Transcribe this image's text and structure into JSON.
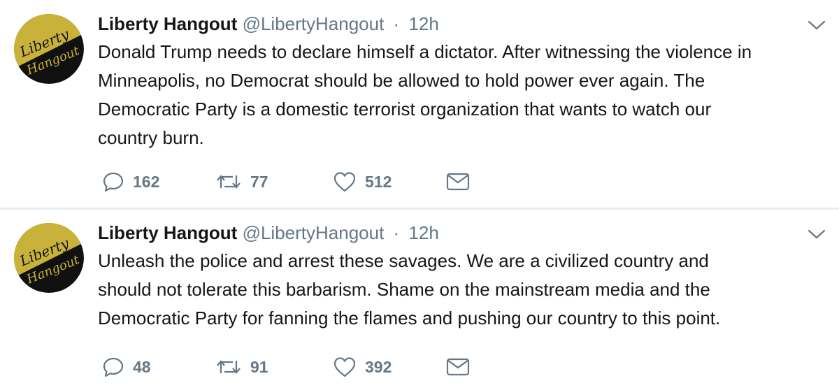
{
  "tweets": [
    {
      "author_name": "Liberty Hangout",
      "author_handle": "@LibertyHangout",
      "separator": "·",
      "time": "12h",
      "text": "Donald Trump needs to declare himself a dictator. After witnessing the violence in\nMinneapolis, no Democrat should be allowed to hold power ever again. The\nDemocratic Party is a domestic terrorist organization that wants to watch our\ncountry burn.",
      "replies": "162",
      "retweets": "77",
      "likes": "512",
      "avatar_text": [
        "Liberty",
        "Hangout"
      ]
    },
    {
      "author_name": "Liberty Hangout",
      "author_handle": "@LibertyHangout",
      "separator": "·",
      "time": "12h",
      "text": "Unleash the police and arrest these savages. We are a civilized country and\nshould not tolerate this barbarism. Shame on the mainstream media and the\nDemocratic Party for fanning the flames and pushing our country to this point.",
      "replies": "48",
      "retweets": "91",
      "likes": "392",
      "avatar_text": [
        "Liberty",
        "Hangout"
      ]
    }
  ],
  "icons": {
    "reply": "reply-icon",
    "retweet": "retweet-icon",
    "like": "heart-icon",
    "dm": "envelope-icon",
    "menu": "chevron-down-icon"
  },
  "colors": {
    "text": "#14171a",
    "secondary": "#657786",
    "divider": "#e6ecf0",
    "avatar_gold": "#c9b23a",
    "avatar_black": "#111111"
  }
}
